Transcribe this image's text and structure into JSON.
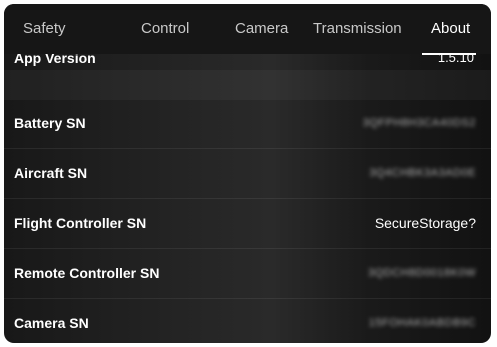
{
  "tabs": [
    {
      "label": "Safety",
      "active": false
    },
    {
      "label": "Control",
      "active": false
    },
    {
      "label": "Camera",
      "active": false
    },
    {
      "label": "Transmission",
      "active": false
    },
    {
      "label": "About",
      "active": true
    }
  ],
  "partial_row": {
    "label": "App Version",
    "value": "1.5.10"
  },
  "rows": [
    {
      "label": "Battery SN",
      "value": "3QFPH8H3CA40DS2"
    },
    {
      "label": "Aircraft SN",
      "value": "3Q4CHBK3A3AD0E"
    },
    {
      "label": "Flight Controller SN",
      "value": "SecureStorage?"
    },
    {
      "label": "Remote Controller SN",
      "value": "3QDCH8D0018K0W"
    },
    {
      "label": "Camera SN",
      "value": "15FOHAK0ABDB9C"
    }
  ]
}
